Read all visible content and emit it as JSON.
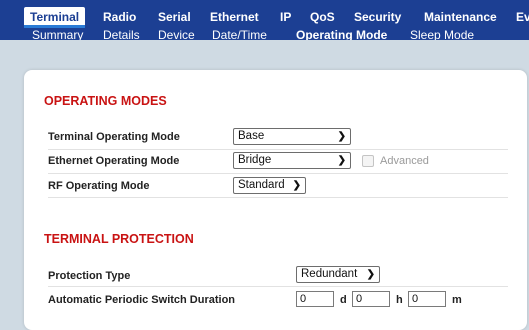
{
  "nav": {
    "tabs": [
      "Terminal",
      "Radio",
      "Serial",
      "Ethernet",
      "IP",
      "QoS",
      "Security",
      "Maintenance",
      "Ev"
    ],
    "subtabs": [
      "Summary",
      "Details",
      "Device",
      "Date/Time",
      "Operating Mode",
      "Sleep Mode"
    ]
  },
  "operating_modes": {
    "title": "OPERATING MODES",
    "terminal_mode_label": "Terminal Operating Mode",
    "terminal_mode_value": "Base",
    "ethernet_mode_label": "Ethernet Operating Mode",
    "ethernet_mode_value": "Bridge",
    "advanced_label": "Advanced",
    "rf_mode_label": "RF Operating Mode",
    "rf_mode_value": "Standard"
  },
  "terminal_protection": {
    "title": "TERMINAL PROTECTION",
    "protection_type_label": "Protection Type",
    "protection_type_value": "Redundant",
    "switch_duration_label": "Automatic Periodic Switch Duration",
    "days_value": "0",
    "days_unit": "d",
    "hours_value": "0",
    "hours_unit": "h",
    "minutes_value": "0",
    "minutes_unit": "m"
  }
}
